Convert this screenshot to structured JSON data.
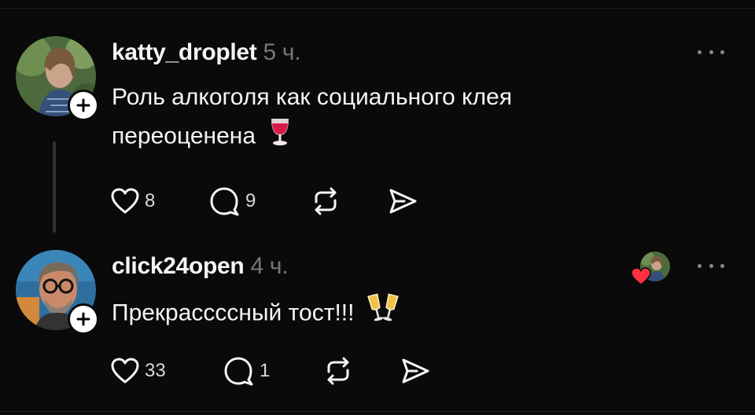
{
  "posts": [
    {
      "username": "katty_droplet",
      "time": "5 ч.",
      "text": "Роль алкоголя как социального клея переоценена",
      "emoji_icon": "wine-glass-icon",
      "likes": "8",
      "replies": "9"
    },
    {
      "username": "click24open",
      "time": "4 ч.",
      "text": "Прекрассссный тост!!!",
      "emoji_icon": "clinking-glasses-icon",
      "likes": "33",
      "replies": "1"
    }
  ],
  "colors": {
    "background": "#0a0a0a",
    "text": "#f3f5f7",
    "muted": "#777777",
    "like_heart": "#ff3040"
  }
}
